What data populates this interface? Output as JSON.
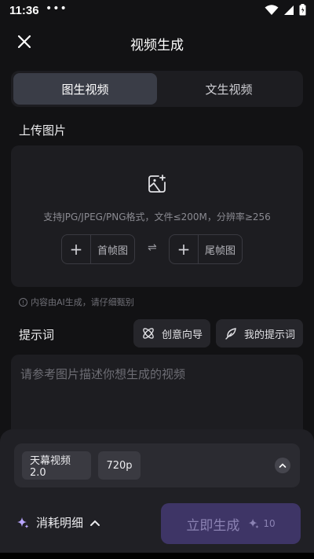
{
  "status_bar": {
    "time": "11:36",
    "dots": "•••"
  },
  "header": {
    "title": "视频生成"
  },
  "mode_tabs": [
    {
      "label": "图生视频",
      "active": true
    },
    {
      "label": "文生视频",
      "active": false
    }
  ],
  "upload": {
    "section_label": "上传图片",
    "hint": "支持JPG/JPEG/PNG格式，文件≤200M，分辨率≥256",
    "first_frame_label": "首帧图",
    "last_frame_label": "尾帧图",
    "plus": "+",
    "swap": "⇌"
  },
  "notice": {
    "text": "内容由AI生成，请仔细甄别",
    "icon_glyph": "!"
  },
  "prompt": {
    "section_label": "提示词",
    "creative_guide_label": "创意向导",
    "my_prompts_label": "我的提示词",
    "placeholder": "请参考图片描述你想生成的视频"
  },
  "bottom": {
    "model": "天幕视频2.0",
    "resolution": "720p",
    "cost_detail_label": "消耗明细",
    "generate_label": "立即生成",
    "cost": "10"
  },
  "colors": {
    "accent": "#3e3566",
    "accent_text": "#8b82b3",
    "background": "#121214",
    "panel": "#1d1d21"
  }
}
